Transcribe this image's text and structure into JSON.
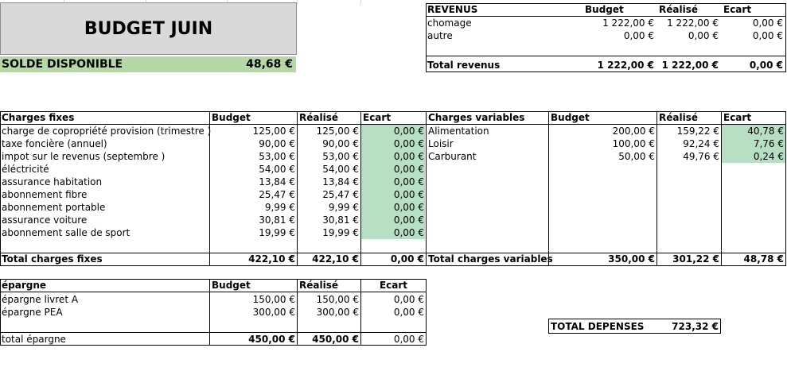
{
  "title": "BUDGET JUIN",
  "solde": {
    "label": "SOLDE DISPONIBLE",
    "value": "48,68 €"
  },
  "revenus": {
    "headers": {
      "name": "REVENUS",
      "budget": "Budget",
      "realise": "Réalisé",
      "ecart": "Ecart"
    },
    "rows": [
      {
        "label": "chomage",
        "budget": "1 222,00 €",
        "realise": "1 222,00 €",
        "ecart": "0,00 €"
      },
      {
        "label": "autre",
        "budget": "0,00 €",
        "realise": "0,00 €",
        "ecart": "0,00 €"
      }
    ],
    "total": {
      "label": "Total revenus",
      "budget": "1 222,00 €",
      "realise": "1 222,00 €",
      "ecart": "0,00 €"
    }
  },
  "fixes": {
    "headers": {
      "name": "Charges fixes",
      "budget": "Budget",
      "realise": "Réalisé",
      "ecart": "Ecart"
    },
    "rows": [
      {
        "label": "charge de copropriété provision (trimestre )",
        "budget": "125,00 €",
        "realise": "125,00 €",
        "ecart": "0,00 €"
      },
      {
        "label": "taxe foncière (annuel)",
        "budget": "90,00 €",
        "realise": "90,00 €",
        "ecart": "0,00 €"
      },
      {
        "label": "impot sur le revenus (septembre )",
        "budget": "53,00 €",
        "realise": "53,00 €",
        "ecart": "0,00 €"
      },
      {
        "label": "éléctricité",
        "budget": "54,00 €",
        "realise": "54,00 €",
        "ecart": "0,00 €"
      },
      {
        "label": "assurance habitation",
        "budget": "13,84 €",
        "realise": "13,84 €",
        "ecart": "0,00 €"
      },
      {
        "label": "abonnement fibre",
        "budget": "25,47 €",
        "realise": "25,47 €",
        "ecart": "0,00 €"
      },
      {
        "label": "abonnement portable",
        "budget": "9,99 €",
        "realise": "9,99 €",
        "ecart": "0,00 €"
      },
      {
        "label": "assurance voiture",
        "budget": "30,81 €",
        "realise": "30,81 €",
        "ecart": "0,00 €"
      },
      {
        "label": "abonnement salle de sport",
        "budget": "19,99 €",
        "realise": "19,99 €",
        "ecart": "0,00 €"
      }
    ],
    "total": {
      "label": "Total charges fixes",
      "budget": "422,10 €",
      "realise": "422,10 €",
      "ecart": "0,00 €"
    }
  },
  "variables": {
    "headers": {
      "name": "Charges variables",
      "budget": "Budget",
      "realise": "Réalisé",
      "ecart": "Ecart"
    },
    "rows": [
      {
        "label": "Alimentation",
        "budget": "200,00 €",
        "realise": "159,22 €",
        "ecart": "40,78 €"
      },
      {
        "label": "Loisir",
        "budget": "100,00 €",
        "realise": "92,24 €",
        "ecart": "7,76 €"
      },
      {
        "label": "Carburant",
        "budget": "50,00 €",
        "realise": "49,76 €",
        "ecart": "0,24 €"
      }
    ],
    "total": {
      "label": "Total charges variables",
      "budget": "350,00 €",
      "realise": "301,22 €",
      "ecart": "48,78 €"
    }
  },
  "epargne": {
    "headers": {
      "name": "épargne",
      "budget": "Budget",
      "realise": "Réalisé",
      "ecart": "Ecart"
    },
    "rows": [
      {
        "label": "épargne livret A",
        "budget": "150,00 €",
        "realise": "150,00 €",
        "ecart": "0,00 €"
      },
      {
        "label": "épargne PEA",
        "budget": "300,00 €",
        "realise": "300,00 €",
        "ecart": "0,00 €"
      }
    ],
    "total": {
      "label": "total épargne",
      "budget": "450,00 €",
      "realise": "450,00 €",
      "ecart": "0,00 €"
    }
  },
  "total_depenses": {
    "label": "TOTAL DEPENSES",
    "value": "723,32 €"
  }
}
